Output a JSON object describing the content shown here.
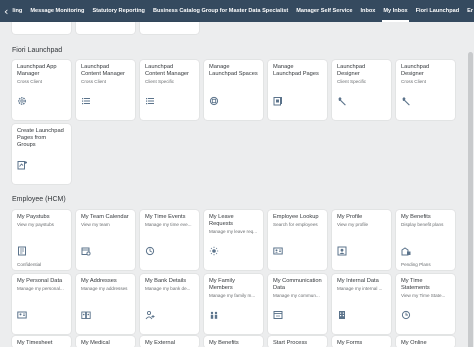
{
  "topbar": {
    "tabs": [
      "ling",
      "Message Monitoring",
      "Statutory Reporting",
      "Business Catalog Group for Master Data Specialist",
      "Manager Self Service",
      "Inbox",
      "My Inbox",
      "Fiori Launchpad",
      "Er"
    ],
    "selected": "My Inbox"
  },
  "sections": {
    "fiori": {
      "title": "Fiori Launchpad",
      "tiles": [
        {
          "title": "Launchpad App Manager",
          "subtitle": "Cross Client",
          "icon": "gear-icon"
        },
        {
          "title": "Launchpad Content Manager",
          "subtitle": "Cross Client",
          "icon": "list-icon"
        },
        {
          "title": "Launchpad Content Manager",
          "subtitle": "Client Specific",
          "icon": "list-icon"
        },
        {
          "title": "Manage Launchpad Spaces",
          "subtitle": "",
          "icon": "spaces-icon"
        },
        {
          "title": "Manage Launchpad Pages",
          "subtitle": "",
          "icon": "pages-icon"
        },
        {
          "title": "Launchpad Designer",
          "subtitle": "Client Specific",
          "icon": "wrench-icon"
        },
        {
          "title": "Launchpad Designer",
          "subtitle": "Cross Client",
          "icon": "wrench-icon"
        },
        {
          "title": "Create Launchpad Pages from Groups",
          "subtitle": "",
          "icon": "create-pages-icon"
        }
      ]
    },
    "employee": {
      "title": "Employee (HCM)",
      "row1": [
        {
          "title": "My Paystubs",
          "subtitle": "View my paystubs",
          "icon": "paystub-icon",
          "footer": "Confidential"
        },
        {
          "title": "My Team Calendar",
          "subtitle": "View my team",
          "icon": "calendar-icon",
          "footer": ""
        },
        {
          "title": "My Time Events",
          "subtitle": "Manage my time eve...",
          "icon": "time-events-icon",
          "footer": ""
        },
        {
          "title": "My Leave Requests",
          "subtitle": "Manage my leave req...",
          "icon": "leave-icon",
          "footer": ""
        },
        {
          "title": "Employee Lookup",
          "subtitle": "Search for employees",
          "icon": "person-card-icon",
          "footer": ""
        },
        {
          "title": "My Profile",
          "subtitle": "View my profile",
          "icon": "profile-icon",
          "footer": ""
        },
        {
          "title": "My Benefits",
          "subtitle": "Display benefit plans",
          "icon": "benefits-icon",
          "footer": "Pending Plans"
        }
      ],
      "row2": [
        {
          "title": "My Personal Data",
          "subtitle": "Manage my personal...",
          "icon": "personal-data-icon"
        },
        {
          "title": "My Addresses",
          "subtitle": "Manage my addresses",
          "icon": "addresses-icon"
        },
        {
          "title": "My Bank Details",
          "subtitle": "Manage my bank de...",
          "icon": "bank-icon"
        },
        {
          "title": "My Family Members",
          "subtitle": "Manage my family m...",
          "icon": "family-icon"
        },
        {
          "title": "My Communication Data",
          "subtitle": "Manage my commun...",
          "icon": "communication-icon"
        },
        {
          "title": "My Internal Data",
          "subtitle": "Manage my internal ...",
          "icon": "building-icon"
        },
        {
          "title": "My Time Statements",
          "subtitle": "View my Time State...",
          "icon": "time-statement-icon"
        }
      ],
      "row3": [
        "My Timesheet",
        "My Medical",
        "My External",
        "My Benefits",
        "Start Process",
        "My Forms",
        "My Online"
      ]
    }
  },
  "colors": {
    "shell": "#354a5f",
    "icon": "#5b738b",
    "background": "#ecedee"
  }
}
